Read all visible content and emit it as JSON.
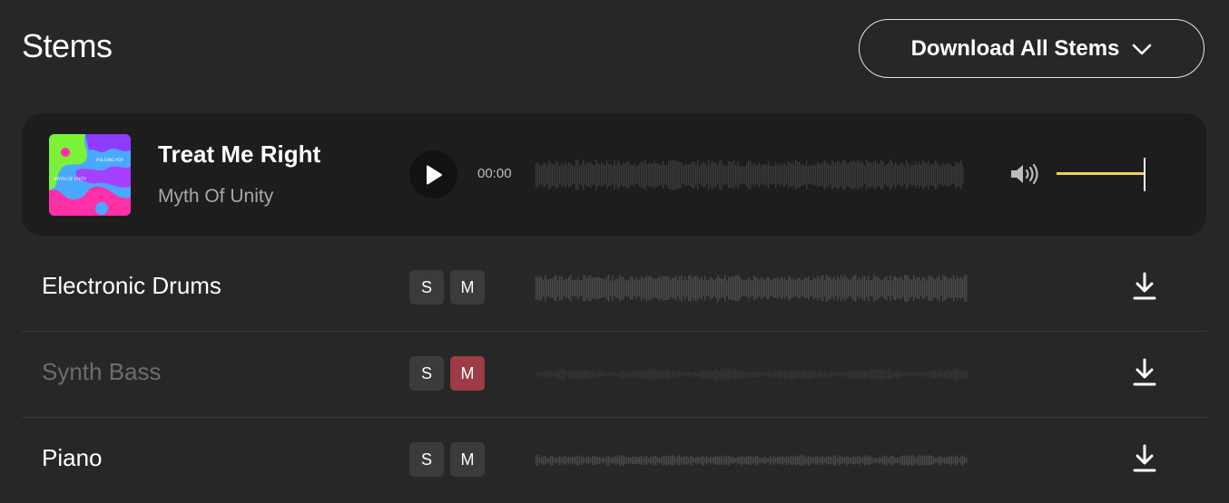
{
  "page": {
    "title": "Stems"
  },
  "download_all": {
    "label": "Download All Stems"
  },
  "player": {
    "track_title": "Treat Me Right",
    "artist": "Myth Of Unity",
    "time": "00:00",
    "volume": 1.0,
    "cover_text_1": "PULSING POP",
    "cover_text_2": "MYTH OF UNITY"
  },
  "stems": [
    {
      "name": "Electronic Drums",
      "solo": "S",
      "mute": "M",
      "muted": false
    },
    {
      "name": "Synth Bass",
      "solo": "S",
      "mute": "M",
      "muted": true
    },
    {
      "name": "Piano",
      "solo": "S",
      "mute": "M",
      "muted": false
    }
  ],
  "colors": {
    "background": "#272727",
    "player_bg": "#1d1d1d",
    "volume_accent": "#f2d15a",
    "mute_active": "#9c3c46"
  }
}
